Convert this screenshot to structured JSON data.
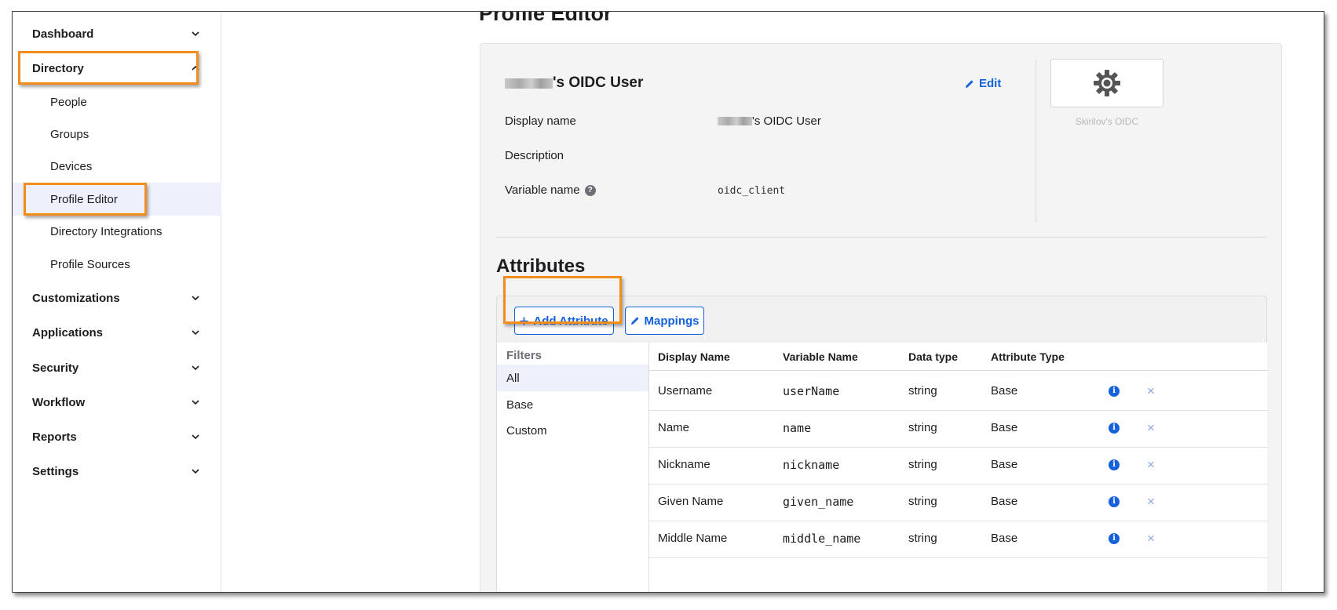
{
  "sidebar": {
    "dashboard": "Dashboard",
    "directory": "Directory",
    "directory_items": [
      "People",
      "Groups",
      "Devices",
      "Profile Editor",
      "Directory Integrations",
      "Profile Sources"
    ],
    "customizations": "Customizations",
    "applications": "Applications",
    "security": "Security",
    "workflow": "Workflow",
    "reports": "Reports",
    "settings": "Settings"
  },
  "page": {
    "title": "Profile Editor"
  },
  "profile": {
    "name_suffix": "'s OIDC User",
    "edit_label": "Edit",
    "display_name_label": "Display name",
    "display_name_suffix": "'s OIDC User",
    "description_label": "Description",
    "variable_name_label": "Variable name",
    "variable_name_value": "oidc_client",
    "logo_caption": "Skirilov's OIDC"
  },
  "attributes": {
    "title": "Attributes",
    "add_button": "Add Attribute",
    "mappings_button": "Mappings",
    "filters_heading": "Filters",
    "filters": [
      "All",
      "Base",
      "Custom"
    ],
    "columns": [
      "Display Name",
      "Variable Name",
      "Data type",
      "Attribute Type"
    ],
    "rows": [
      {
        "display": "Username",
        "variable": "userName",
        "type": "string",
        "attr_type": "Base"
      },
      {
        "display": "Name",
        "variable": "name",
        "type": "string",
        "attr_type": "Base"
      },
      {
        "display": "Nickname",
        "variable": "nickname",
        "type": "string",
        "attr_type": "Base"
      },
      {
        "display": "Given Name",
        "variable": "given_name",
        "type": "string",
        "attr_type": "Base"
      },
      {
        "display": "Middle Name",
        "variable": "middle_name",
        "type": "string",
        "attr_type": "Base"
      }
    ]
  },
  "colors": {
    "accent": "#1662dd",
    "highlight": "#f28c1b",
    "active_bg": "#eef0fb"
  }
}
